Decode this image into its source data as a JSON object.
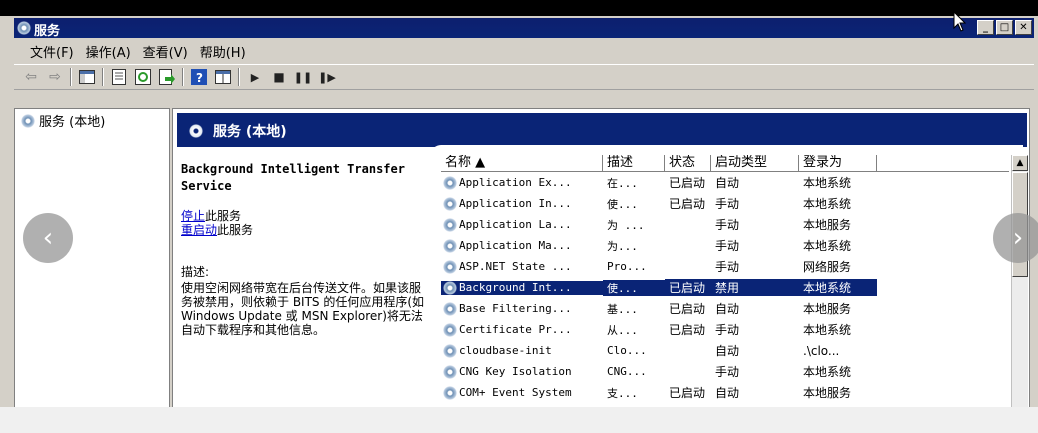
{
  "window": {
    "title": "服务",
    "controls": {
      "minimize": "_",
      "restore": "□",
      "close": "✕"
    }
  },
  "menu": [
    "文件(F)",
    "操作(A)",
    "查看(V)",
    "帮助(H)"
  ],
  "toolbar": [
    "back-icon",
    "forward-icon",
    "show-hide-tree-icon",
    "properties-icon",
    "refresh-icon",
    "export-icon",
    "help-icon",
    "view-icon",
    "play-icon",
    "stop-icon",
    "pause-icon",
    "resume-icon"
  ],
  "tree": {
    "item": "服务 (本地)"
  },
  "content": {
    "header": "服务 (本地)",
    "selected_service_name": "Background Intelligent Transfer Service",
    "stop_link": "停止",
    "stop_suffix": "此服务",
    "restart_link": "重启动",
    "restart_suffix": "此服务",
    "desc_label": "描述:",
    "desc_text": "使用空闲网络带宽在后台传送文件。如果该服务被禁用，则依赖于 BITS 的任何应用程序(如 Windows Update 或 MSN Explorer)将无法自动下载程序和其他信息。"
  },
  "grid": {
    "columns": [
      "名称 ▲",
      "描述",
      "状态",
      "启动类型",
      "登录为"
    ],
    "rows": [
      {
        "name": "Application Ex...",
        "desc": "在...",
        "status": "已启动",
        "startup": "自动",
        "logon": "本地系统"
      },
      {
        "name": "Application In...",
        "desc": "使...",
        "status": "已启动",
        "startup": "手动",
        "logon": "本地系统"
      },
      {
        "name": "Application La...",
        "desc": "为 ...",
        "status": "",
        "startup": "手动",
        "logon": "本地服务"
      },
      {
        "name": "Application Ma...",
        "desc": "为...",
        "status": "",
        "startup": "手动",
        "logon": "本地系统"
      },
      {
        "name": "ASP.NET State ...",
        "desc": "Pro...",
        "status": "",
        "startup": "手动",
        "logon": "网络服务"
      },
      {
        "name": "Background Int...",
        "desc": "使...",
        "status": "已启动",
        "startup": "禁用",
        "logon": "本地系统",
        "selected": true
      },
      {
        "name": "Base Filtering...",
        "desc": "基...",
        "status": "已启动",
        "startup": "自动",
        "logon": "本地服务"
      },
      {
        "name": "Certificate Pr...",
        "desc": "从...",
        "status": "已启动",
        "startup": "手动",
        "logon": "本地系统"
      },
      {
        "name": "cloudbase-init",
        "desc": "Clo...",
        "status": "",
        "startup": "自动",
        "logon": ".\\clo..."
      },
      {
        "name": "CNG Key Isolation",
        "desc": "CNG...",
        "status": "",
        "startup": "手动",
        "logon": "本地系统"
      },
      {
        "name": "COM+ Event System",
        "desc": "支...",
        "status": "已启动",
        "startup": "自动",
        "logon": "本地服务"
      }
    ]
  },
  "nav": {
    "prev": "‹",
    "next": "›"
  }
}
